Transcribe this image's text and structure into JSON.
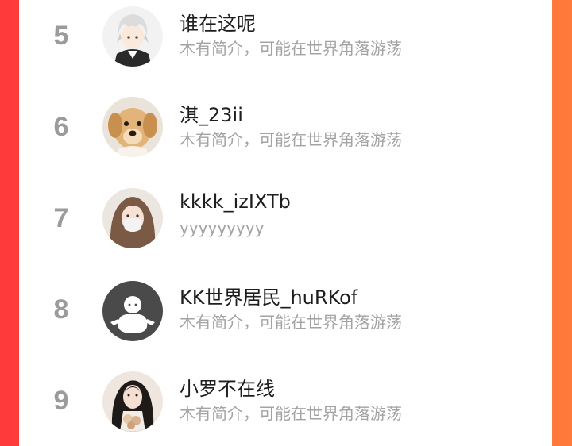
{
  "ranking": {
    "items": [
      {
        "rank": "5",
        "name": "谁在这呢",
        "bio": "木有简介，可能在世界角落游荡",
        "avatar_icon": "anime-boy-avatar-icon"
      },
      {
        "rank": "6",
        "name": "淇_23ii",
        "bio": "木有简介，可能在世界角落游荡",
        "avatar_icon": "golden-puppy-avatar-icon"
      },
      {
        "rank": "7",
        "name": "kkkk_izIXTb",
        "bio": "yyyyyyyyy",
        "avatar_icon": "masked-girl-avatar-icon"
      },
      {
        "rank": "8",
        "name": "KK世界居民_huRKof",
        "bio": "木有简介，可能在世界角落游荡",
        "avatar_icon": "default-user-avatar-icon"
      },
      {
        "rank": "9",
        "name": "小罗不在线",
        "bio": "木有简介，可能在世界角落游荡",
        "avatar_icon": "girl-with-flowers-avatar-icon"
      }
    ]
  },
  "colors": {
    "background_gradient_start": "#ff3a3a",
    "background_gradient_end": "#ff7b3a",
    "card": "#ffffff",
    "rank": "#9b9b9b",
    "name": "#1e1e1e",
    "bio": "#a3a3a3"
  }
}
